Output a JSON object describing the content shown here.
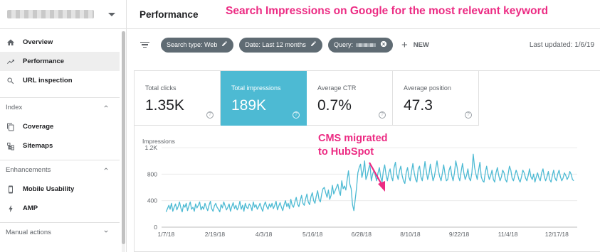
{
  "header": {
    "title": "Performance"
  },
  "annotations": {
    "top": "Search Impressions on Google for the most relevant keyword",
    "chart_line1": "CMS migrated",
    "chart_line2": "to HubSpot"
  },
  "sidebar": {
    "items": [
      {
        "label": "Overview",
        "icon": "home-icon"
      },
      {
        "label": "Performance",
        "icon": "trending-icon",
        "active": true
      },
      {
        "label": "URL inspection",
        "icon": "search-icon"
      }
    ],
    "sections": [
      {
        "label": "Index",
        "items": [
          {
            "label": "Coverage",
            "icon": "copy-icon"
          },
          {
            "label": "Sitemaps",
            "icon": "sitemap-icon"
          }
        ]
      },
      {
        "label": "Enhancements",
        "items": [
          {
            "label": "Mobile Usability",
            "icon": "phone-icon"
          },
          {
            "label": "AMP",
            "icon": "bolt-icon"
          }
        ]
      },
      {
        "label": "Manual actions",
        "items": []
      }
    ]
  },
  "filters": {
    "search_type": "Search type: Web",
    "date": "Date: Last 12 months",
    "query": "Query:",
    "new_label": "NEW",
    "last_updated": "Last updated: 1/6/19"
  },
  "metrics": [
    {
      "label": "Total clicks",
      "value": "1.35K",
      "selected": false
    },
    {
      "label": "Total impressions",
      "value": "189K",
      "selected": true
    },
    {
      "label": "Average CTR",
      "value": "0.7%",
      "selected": false
    },
    {
      "label": "Average position",
      "value": "47.3",
      "selected": false
    }
  ],
  "colors": {
    "accent": "#4dbad3",
    "chip": "#5f6b73",
    "annotation": "#ec2b83",
    "line": "#4dbad3"
  },
  "chart_data": {
    "type": "line",
    "ylabel": "Impressions",
    "ylim": [
      0,
      1200
    ],
    "y_ticks": [
      "1.2K",
      "800",
      "400",
      "0"
    ],
    "y_tick_values": [
      1200,
      800,
      400,
      0
    ],
    "x_ticks": [
      "1/7/18",
      "2/19/18",
      "4/3/18",
      "5/16/18",
      "6/28/18",
      "8/10/18",
      "9/22/18",
      "11/4/18",
      "12/17/18"
    ],
    "x_tick_days": [
      0,
      43,
      86,
      129,
      172,
      215,
      258,
      301,
      344
    ],
    "x_range_days": [
      -4,
      362
    ],
    "series": [
      {
        "values": [
          230,
          280,
          330,
          270,
          360,
          240,
          300,
          350,
          260,
          310,
          380,
          290,
          230,
          340,
          300,
          360,
          250,
          320,
          380,
          270,
          300,
          240,
          350,
          290,
          330,
          380,
          260,
          310,
          270,
          360,
          300,
          250,
          330,
          390,
          280,
          240,
          320,
          360,
          300,
          270,
          230,
          340,
          290,
          380,
          320,
          260,
          300,
          350,
          240,
          310,
          370,
          280,
          330,
          260,
          300,
          390,
          270,
          330,
          240,
          360,
          300,
          280,
          350,
          320,
          250,
          380,
          300,
          340,
          270,
          310,
          360,
          290,
          240,
          330,
          380,
          310,
          270,
          350,
          300,
          360,
          280,
          330,
          390,
          260,
          320,
          370,
          300,
          250,
          340,
          400,
          310,
          360,
          280,
          420,
          330,
          300,
          380,
          450,
          350,
          310,
          400,
          480,
          360,
          330,
          430,
          500,
          380,
          340,
          460,
          520,
          400,
          360,
          470,
          550,
          420,
          380,
          500,
          580,
          600,
          520,
          450,
          560,
          420,
          480,
          630,
          500,
          550,
          600,
          650,
          540,
          480,
          700,
          580,
          620,
          560,
          720,
          850,
          650,
          580,
          340,
          250,
          420,
          600,
          820,
          900,
          950,
          750,
          850,
          1000,
          720,
          780,
          880,
          950,
          700,
          800,
          860,
          780,
          700,
          820,
          900,
          760,
          680,
          850,
          940,
          790,
          700,
          820,
          880,
          760,
          700,
          900,
          980,
          800,
          720,
          850,
          920,
          780,
          700,
          660,
          820,
          900,
          760,
          700,
          840,
          960,
          820,
          720,
          680,
          880,
          920,
          760,
          700,
          840,
          990,
          850,
          720,
          800,
          950,
          820,
          700,
          760,
          880,
          1000,
          860,
          760,
          700,
          820,
          940,
          800,
          700,
          720,
          860,
          920,
          780,
          700,
          820,
          1000,
          900,
          760,
          700,
          840,
          960,
          820,
          720,
          780,
          880,
          740,
          700,
          820,
          1100,
          900,
          800,
          720,
          860,
          980,
          760,
          700,
          680,
          820,
          920,
          800,
          720,
          780,
          860,
          720,
          680,
          820,
          900,
          780,
          700,
          760,
          860,
          820,
          720,
          680,
          800,
          920,
          860,
          740,
          700,
          780,
          860,
          800,
          720,
          680,
          760,
          860,
          820,
          740,
          700,
          780,
          880,
          760,
          720,
          800,
          680,
          760,
          820,
          740,
          700,
          820,
          880,
          760,
          700,
          760,
          840,
          720,
          680,
          780,
          860,
          740,
          700,
          800,
          860,
          760,
          700,
          740,
          820,
          780,
          720,
          760,
          840,
          800,
          720,
          700
        ]
      }
    ]
  }
}
